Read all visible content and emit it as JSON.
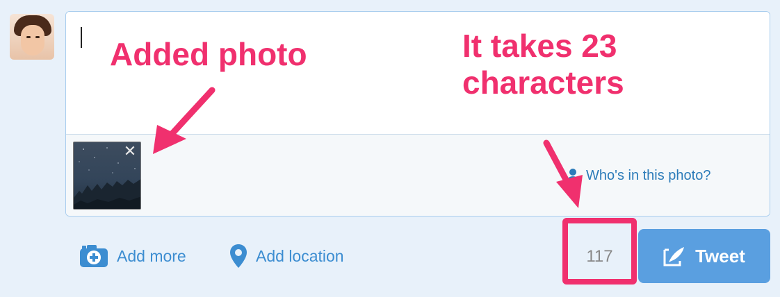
{
  "composer": {
    "text": "",
    "media": {
      "remove_icon": "close-icon",
      "tag_people_label": "Who's in this photo?"
    }
  },
  "toolbar": {
    "add_more_label": "Add more",
    "add_location_label": "Add location",
    "char_counter": "117",
    "tweet_label": "Tweet"
  },
  "annotations": {
    "added_photo": "Added photo",
    "takes_chars_line1": "It takes 23",
    "takes_chars_line2": "characters",
    "highlight_color": "#f0306e"
  },
  "colors": {
    "accent": "#3c8dd1",
    "tweet_button": "#5a9fe0",
    "background": "#e8f1fa"
  }
}
